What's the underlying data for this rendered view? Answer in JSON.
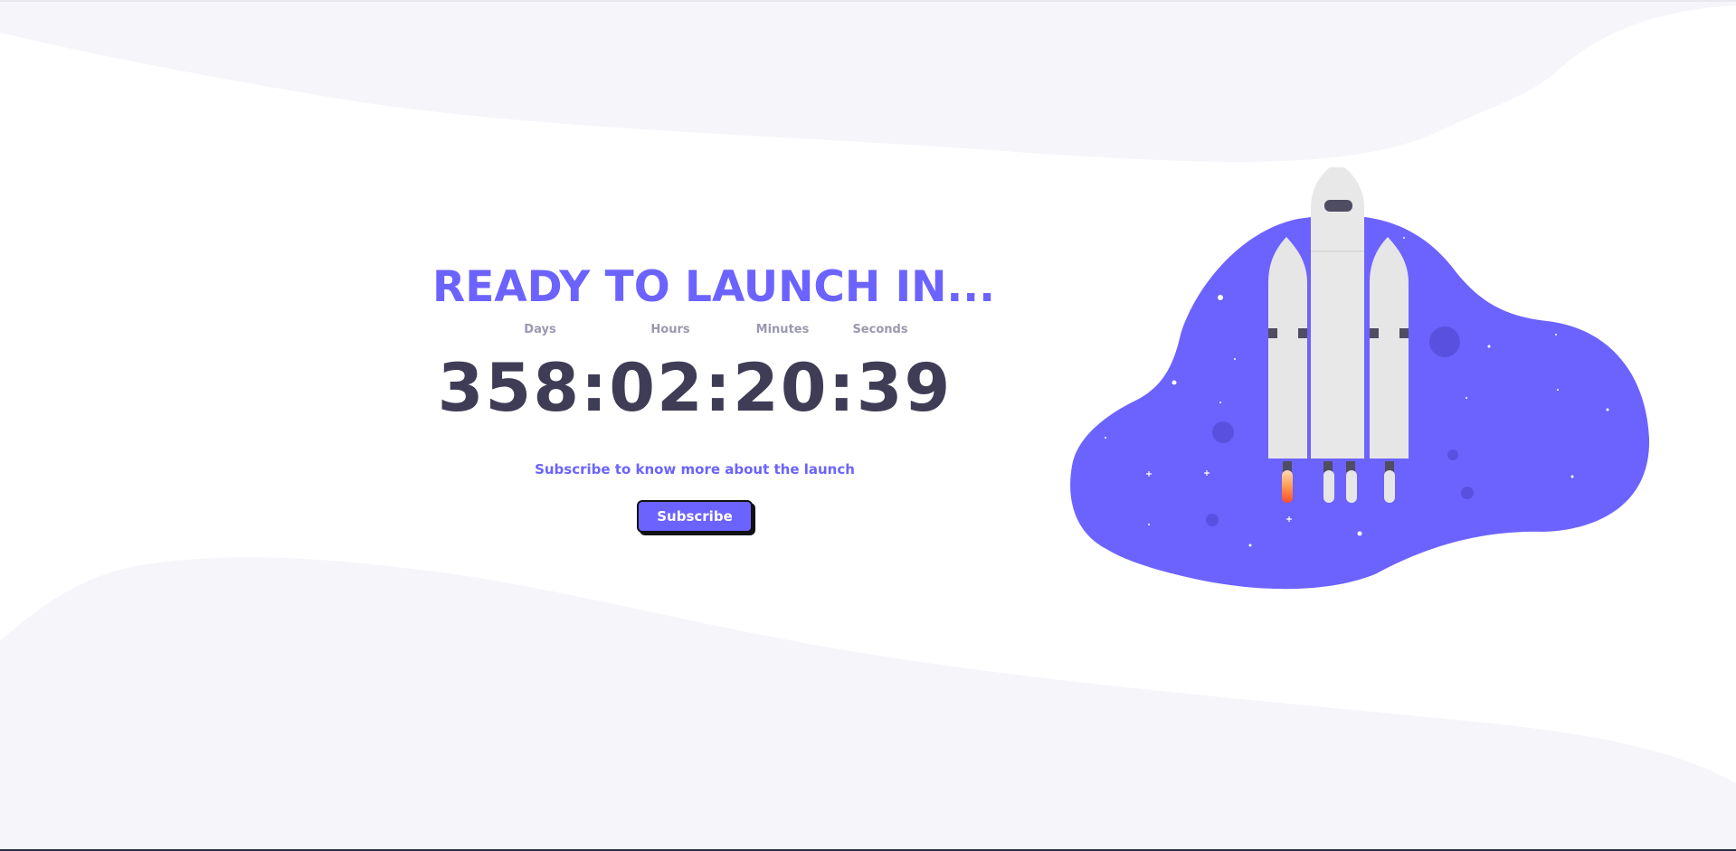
{
  "headline": "READY TO LAUNCH IN...",
  "countdown": {
    "units": [
      {
        "label": "Days"
      },
      {
        "label": "Hours"
      },
      {
        "label": "Minutes"
      },
      {
        "label": "Seconds"
      }
    ],
    "display": "358:02:20:39",
    "days": "358",
    "hours": "02",
    "minutes": "20",
    "seconds": "39"
  },
  "subscribe": {
    "prompt": "Subscribe to know more about the launch",
    "button_label": "Subscribe"
  },
  "colors": {
    "accent": "#6c63ff",
    "timer_text": "#3f3d56",
    "unit_label": "#9a99b0",
    "wave_background": "#f5f5fa",
    "rocket_body": "#e6e6e6",
    "rocket_window": "#4f4d62",
    "flame": "#ff6b3d"
  },
  "icons": {
    "rocket": "rocket-illustration",
    "space_blob": "space-blob"
  }
}
